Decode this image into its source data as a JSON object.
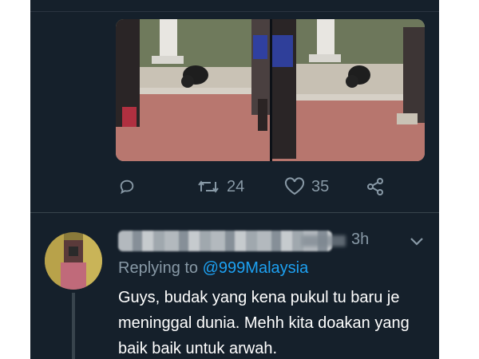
{
  "tweet": {
    "retweet_count": "24",
    "like_count": "35"
  },
  "reply": {
    "time": "3h",
    "replying_prefix": "Replying to",
    "replying_handle": "@999Malaysia",
    "text": "Guys, budak yang kena pukul tu baru je meninggal dunia. Mehh kita doakan yang baik baik untuk arwah."
  },
  "icons": {
    "reply": "reply-icon",
    "retweet": "retweet-icon",
    "like": "heart-icon",
    "share": "share-icon",
    "caret": "chevron-down-icon"
  },
  "colors": {
    "background": "#15202b",
    "secondary_text": "#8899a6",
    "link": "#1da1f2",
    "divider": "#38444d"
  }
}
